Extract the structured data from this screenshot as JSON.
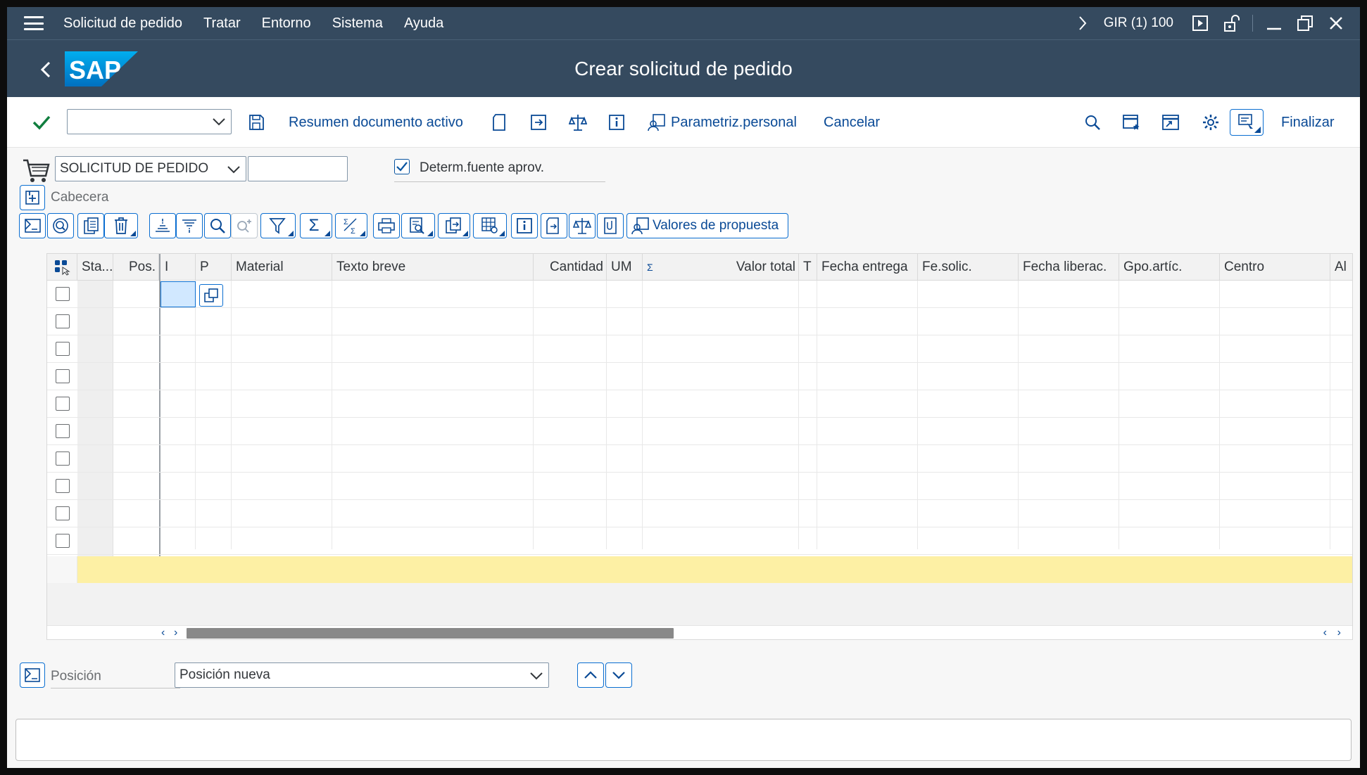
{
  "menubar": {
    "items": [
      "Solicitud de pedido",
      "Tratar",
      "Entorno",
      "Sistema",
      "Ayuda"
    ],
    "system": "GIR (1) 100"
  },
  "titlebar": {
    "title": "Crear solicitud de pedido",
    "logo_text": "SAP"
  },
  "toolbar": {
    "resumen": "Resumen documento activo",
    "parametriz": "Parametriz.personal",
    "cancelar": "Cancelar",
    "finalizar": "Finalizar",
    "command_value": ""
  },
  "header": {
    "doc_type": "SOLICITUD DE PEDIDO",
    "doc_number": "",
    "determ_label": "Determ.fuente aprov.",
    "determ_checked": true,
    "cabecera_label": "Cabecera"
  },
  "grid_toolbar": {
    "valores": "Valores de propuesta"
  },
  "table": {
    "columns": [
      "Sta...",
      "Pos.",
      "I",
      "P",
      "Material",
      "Texto breve",
      "Cantidad",
      "UM",
      "Σ",
      "Valor total",
      "T",
      "Fecha entrega",
      "Fe.solic.",
      "Fecha liberac.",
      "Gpo.artíc.",
      "Centro",
      "Al"
    ],
    "row_count": 10
  },
  "position": {
    "label": "Posición",
    "value": "Posición nueva"
  },
  "colors": {
    "shell": "#354a5f",
    "accent": "#0a6ed1",
    "link": "#0a4a96",
    "highlight": "#fdf0a4"
  }
}
